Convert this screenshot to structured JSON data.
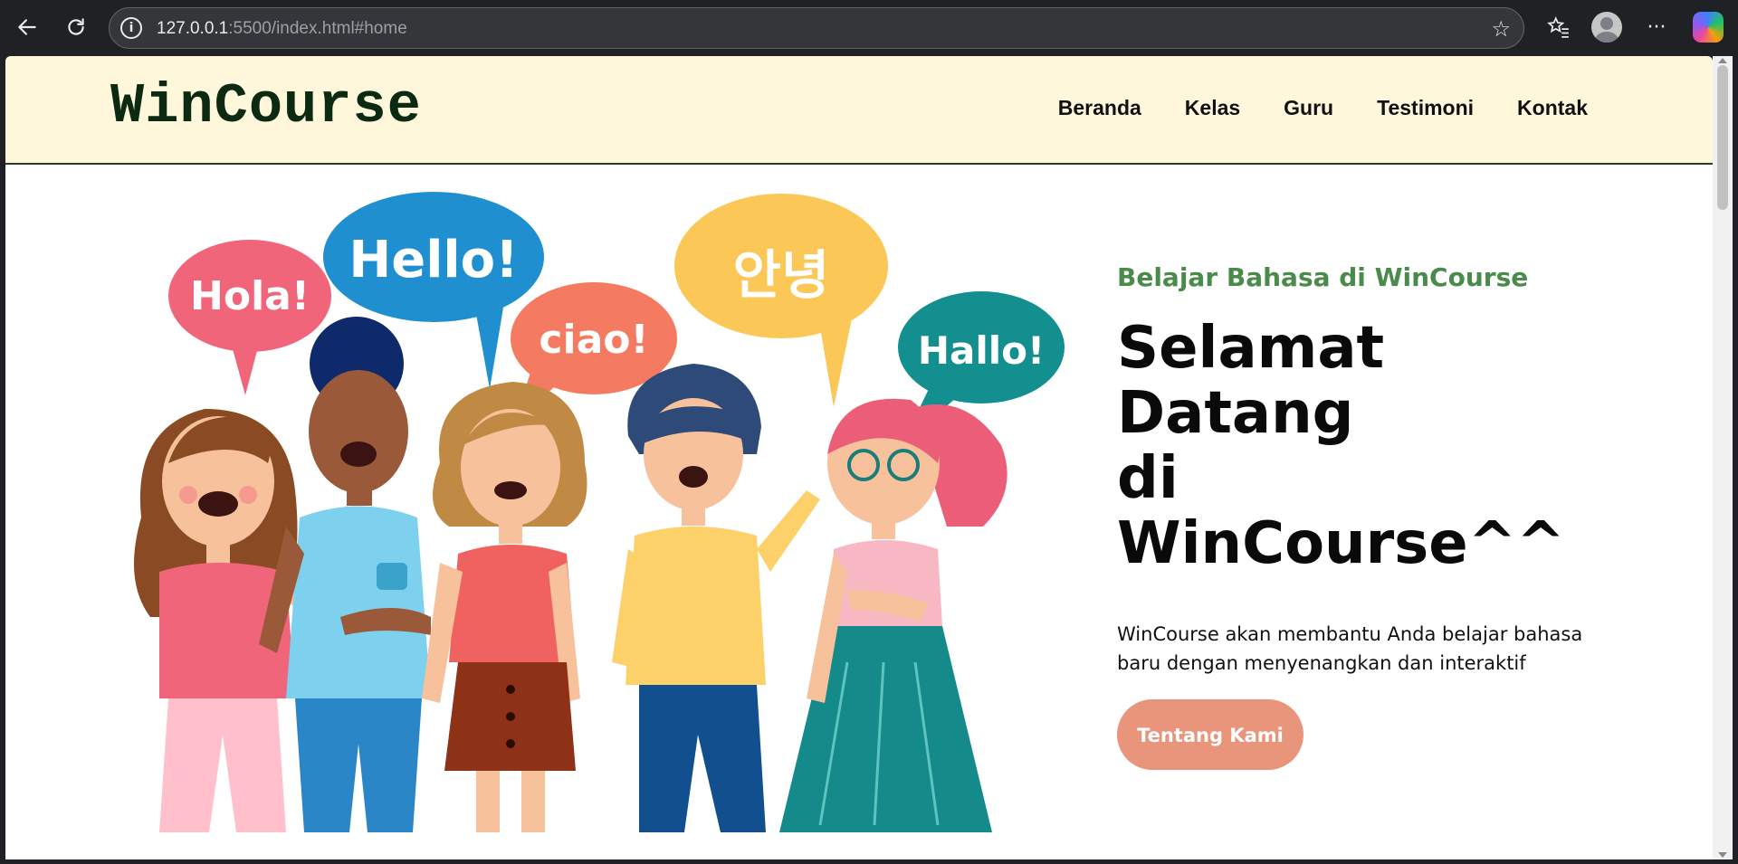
{
  "browser": {
    "url_host": "127.0.0.1",
    "url_path": ":5500/index.html#home",
    "icons": [
      "back-arrow-icon",
      "reload-icon",
      "site-info-icon",
      "bookmark-star-icon",
      "favorites-icon",
      "profile-avatar-icon",
      "more-menu-icon",
      "copilot-icon"
    ]
  },
  "site": {
    "logo": "WinCourse",
    "nav": [
      "Beranda",
      "Kelas",
      "Guru",
      "Testimoni",
      "Kontak"
    ]
  },
  "hero": {
    "eyebrow": "Belajar Bahasa di WinCourse",
    "headline_line1": "Selamat Datang",
    "headline_line2": "di WinCourse^^",
    "description": "WinCourse akan membantu Anda belajar bahasa baru dengan menyenangkan dan interaktif",
    "cta_label": "Tentang Kami",
    "speech_bubbles": [
      "Hola!",
      "Hello!",
      "ciao!",
      "안녕",
      "Hallo!"
    ]
  },
  "colors": {
    "header_bg": "#fff7dc",
    "logo": "#0c2a12",
    "eyebrow": "#4a8a4a",
    "cta_bg": "#e8957c"
  }
}
